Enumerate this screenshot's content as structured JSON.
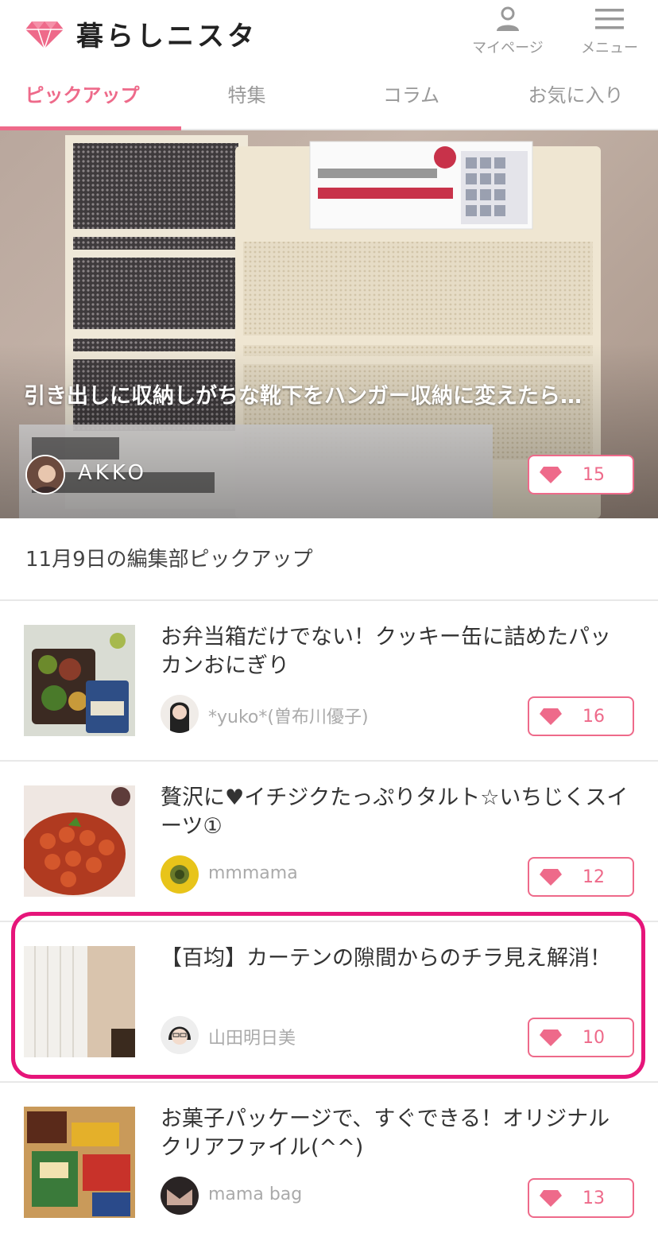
{
  "header": {
    "logo_text": "暮らしニスタ",
    "mypage_label": "マイページ",
    "menu_label": "メニュー"
  },
  "tabs": [
    {
      "label": "ピックアップ",
      "active": true
    },
    {
      "label": "特集",
      "active": false
    },
    {
      "label": "コラム",
      "active": false
    },
    {
      "label": "お気に入り",
      "active": false
    }
  ],
  "hero": {
    "title": "引き出しに収納しがちな靴下をハンガー収納に変えたら…",
    "author": "AKKO",
    "likes": "15"
  },
  "section_title": "11月9日の編集部ピックアップ",
  "articles": [
    {
      "title": "お弁当箱だけでない！クッキー缶に詰めたパッカンおにぎり",
      "author": "*yuko*(曽布川優子)",
      "likes": "16"
    },
    {
      "title": "贅沢に♥イチジクたっぷりタルト☆いちじくスイーツ①",
      "author": "mmmama",
      "likes": "12"
    },
    {
      "title": "【百均】カーテンの隙間からのチラ見え解消！",
      "author": "山田明日美",
      "likes": "10"
    },
    {
      "title": "お菓子パッケージで、すぐできる！オリジナルクリアファイル(^^)",
      "author": "mama bag",
      "likes": "13"
    }
  ],
  "colors": {
    "accent": "#ee6a8a",
    "highlight": "#e6157a"
  }
}
